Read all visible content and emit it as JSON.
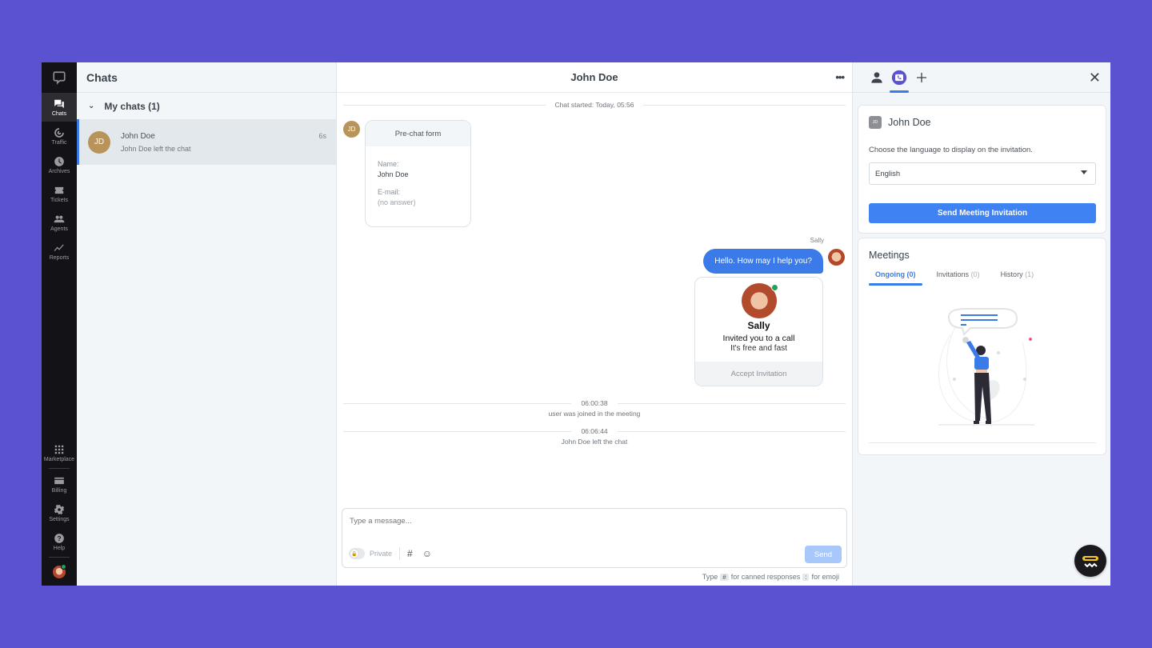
{
  "nav": {
    "items": [
      {
        "label": "Chats",
        "icon": "chats-icon",
        "active": true
      },
      {
        "label": "Traffic",
        "icon": "traffic-icon"
      },
      {
        "label": "Archives",
        "icon": "archives-icon"
      },
      {
        "label": "Tickets",
        "icon": "tickets-icon"
      },
      {
        "label": "Agents",
        "icon": "agents-icon"
      },
      {
        "label": "Reports",
        "icon": "reports-icon"
      }
    ],
    "bottom_items": [
      {
        "label": "Marketplace",
        "icon": "marketplace-icon"
      },
      {
        "label": "Billing",
        "icon": "billing-icon"
      },
      {
        "label": "Settings",
        "icon": "settings-icon"
      },
      {
        "label": "Help",
        "icon": "help-icon"
      }
    ],
    "status_color": "#1fa35a"
  },
  "chatlist": {
    "title": "Chats",
    "group_label": "My chats (1)",
    "items": [
      {
        "initials": "JD",
        "name": "John Doe",
        "preview": "John Doe left the chat",
        "time": "6s"
      }
    ]
  },
  "conversation": {
    "title": "John Doe",
    "more_label": "•••",
    "started": "Chat started: Today, 05:56",
    "visitor_initials": "JD",
    "prechat": {
      "title": "Pre-chat form",
      "fields": [
        {
          "label": "Name:",
          "value": "John Doe"
        },
        {
          "label": "E-mail:",
          "value": "(no answer)"
        }
      ]
    },
    "agent_name": "Sally",
    "agent_message": "Hello. How may I help you?",
    "invite": {
      "name": "Sally",
      "text": "Invited you to a call",
      "sub": "It's free and fast",
      "accept": "Accept Invitation"
    },
    "events": [
      {
        "time": "06:00:38",
        "text": "user was joined in the meeting"
      },
      {
        "time": "06:06:44",
        "text": "John Doe left the chat"
      }
    ],
    "composer": {
      "placeholder": "Type a message...",
      "private_label": "Private",
      "hash_label": "#",
      "emoji_label": "☺",
      "send_label": "Send"
    },
    "hint": {
      "type": "Type",
      "hash_key": "#",
      "canned": "for canned responses",
      "colon_key": ":",
      "emoji": "for emoji"
    }
  },
  "side": {
    "close_label": "✕",
    "invite_card": {
      "initials": "JD",
      "name": "John Doe",
      "description": "Choose the language to display on the invitation.",
      "language": "English",
      "button": "Send Meeting Invitation"
    },
    "meetings": {
      "title": "Meetings",
      "tabs": [
        {
          "label": "Ongoing",
          "count": "(0)",
          "active": true
        },
        {
          "label": "Invitations",
          "count": "(0)"
        },
        {
          "label": "History",
          "count": "(1)"
        }
      ]
    },
    "accent": "#3b7be9",
    "brand_purple": "#5b52d1"
  }
}
